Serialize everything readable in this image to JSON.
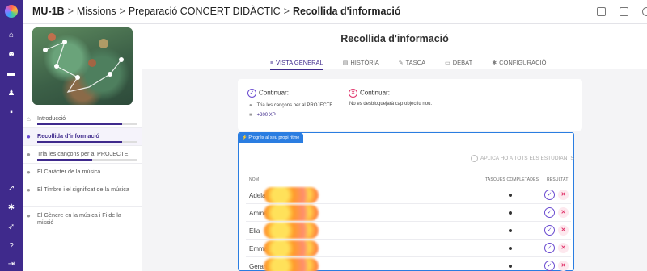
{
  "breadcrumb": {
    "course": "MU-1B",
    "missions": "Missions",
    "mission": "Preparació CONCERT DIDÀCTIC",
    "current": "Recollida d'informació"
  },
  "sidebar": {
    "items": [
      {
        "label": "Introducció",
        "progress": 0.85,
        "active": false
      },
      {
        "label": "Recollida d'informació",
        "progress": 0.85,
        "active": true
      },
      {
        "label": "Tria les cançons per al PROJECTE",
        "progress": 0.55,
        "active": false
      },
      {
        "label": "El Caràcter de la música",
        "progress": 0.0,
        "active": false
      },
      {
        "label": "El Timbre i el significat de la música",
        "progress": 0.0,
        "active": false
      },
      {
        "label": "El Gènere en la música i Fi de la missió",
        "progress": 0.0,
        "active": false
      }
    ]
  },
  "main": {
    "title": "Recollida d'informació",
    "tabs": [
      {
        "label": "VISTA GENERAL",
        "icon": "list-icon",
        "active": true
      },
      {
        "label": "HISTÒRIA",
        "icon": "book-icon",
        "active": false
      },
      {
        "label": "TASCA",
        "icon": "edit-icon",
        "active": false
      },
      {
        "label": "DEBAT",
        "icon": "chat-icon",
        "active": false
      },
      {
        "label": "CONFIGURACIÓ",
        "icon": "gear-icon",
        "active": false
      }
    ]
  },
  "outcomes": {
    "success": {
      "title": "Continuar:",
      "target": "Tria les cançons per al PROJECTE",
      "reward": "+200 XP"
    },
    "failure": {
      "title": "Continuar:",
      "description": "No es desbloquejarà cap objectiu nou."
    }
  },
  "self_paced": {
    "tab_label": "Progrés al seu propi ritme",
    "apply_all": "APLICA HO A TOTS ELS ESTUDIANTS",
    "columns": {
      "name": "NOM",
      "completed": "TASQUES COMPLETADES",
      "result": "RESULTAT"
    },
    "students": [
      {
        "name": "Adela"
      },
      {
        "name": "Amina"
      },
      {
        "name": "Elia"
      },
      {
        "name": "Emma"
      },
      {
        "name": "Gerard"
      }
    ]
  },
  "colors": {
    "brand": "#3f2a8c",
    "accent": "#6a4bd0",
    "reject": "#e0336a",
    "self_paced": "#2a7de1"
  }
}
